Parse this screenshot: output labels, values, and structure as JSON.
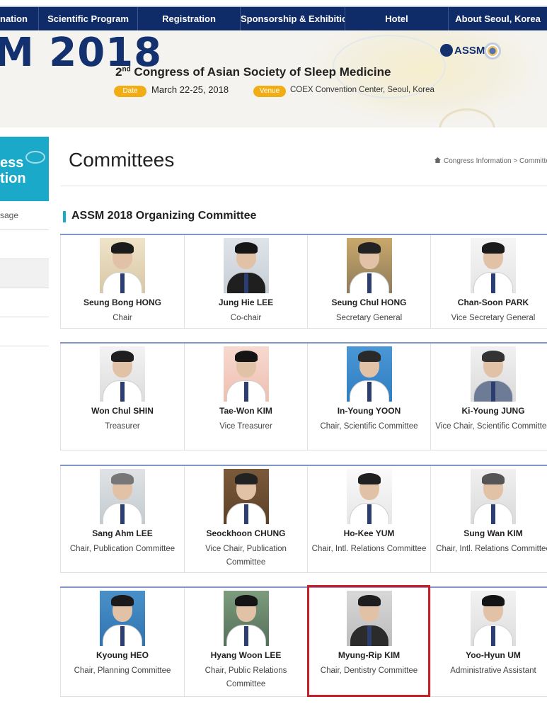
{
  "nav": {
    "items": [
      "nation",
      "Scientific Program",
      "Registration",
      "Sponsorship & Exhibition",
      "Hotel",
      "About Seoul, Korea"
    ]
  },
  "banner": {
    "year": "M 2018",
    "congress_ordinal": "2",
    "congress_ordinal_suffix": "nd",
    "congress_title": "Congress of Asian Society of Sleep Medicine",
    "date_label": "Date",
    "date_value": "March 22-25, 2018",
    "venue_label": "Venue",
    "venue_value": "COEX Convention Center, Seoul, Korea",
    "logo_text": "ASSM"
  },
  "sidebar": {
    "head_line1": "ess",
    "head_line2": "tion",
    "items": [
      "sage",
      "",
      "",
      "",
      ""
    ]
  },
  "page": {
    "title": "Committees",
    "breadcrumb": "Congress Information > Committe"
  },
  "section": {
    "title": "ASSM 2018 Organizing Committee"
  },
  "members": [
    {
      "name": "Seung Bong HONG",
      "role": "Chair"
    },
    {
      "name": "Jung Hie LEE",
      "role": "Co-chair"
    },
    {
      "name": "Seung Chul HONG",
      "role": "Secretary General"
    },
    {
      "name": "Chan-Soon PARK",
      "role": "Vice Secretary General"
    },
    {
      "name": "Won Chul SHIN",
      "role": "Treasurer"
    },
    {
      "name": "Tae-Won KIM",
      "role": "Vice Treasurer"
    },
    {
      "name": "In-Young YOON",
      "role": "Chair, Scientific Committee"
    },
    {
      "name": "Ki-Young JUNG",
      "role": "Vice Chair, Scientific Committee"
    },
    {
      "name": "Sang Ahm LEE",
      "role": "Chair, Publication Committee"
    },
    {
      "name": "Seockhoon CHUNG",
      "role": "Vice Chair, Publication Committee"
    },
    {
      "name": "Ho-Kee YUM",
      "role": "Chair, Intl. Relations Committee"
    },
    {
      "name": "Sung Wan KIM",
      "role": "Chair, Intl. Relations Committee"
    },
    {
      "name": "Kyoung HEO",
      "role": "Chair, Planning Committee"
    },
    {
      "name": "Hyang Woon LEE",
      "role": "Chair, Public Relations Committee"
    },
    {
      "name": "Myung-Rip KIM",
      "role": "Chair, Dentistry Committee"
    },
    {
      "name": "Yoo-Hyun UM",
      "role": "Administrative Assistant"
    }
  ],
  "colors": {
    "nav_bg": "#0f2b68",
    "accent_teal": "#1aa9c8",
    "pill_orange": "#f0ad15",
    "row_border": "#7f96c6",
    "highlight_red": "#c8202a"
  }
}
